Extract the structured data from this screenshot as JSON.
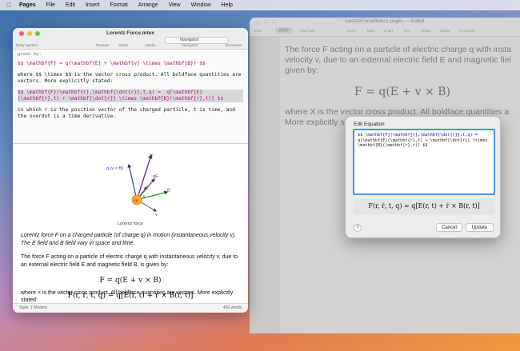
{
  "menubar": {
    "app": "Pages",
    "items": [
      "File",
      "Edit",
      "Insert",
      "Format",
      "Arrange",
      "View",
      "Window",
      "Help"
    ]
  },
  "left_window": {
    "title": "Lorentz Force.mtex",
    "toolbar": {
      "entry_symbol": "Entry Symbol",
      "preview": "Preview",
      "share": "Share",
      "media": "Media",
      "navigator": "Navigator",
      "navigator_select": "Navigator",
      "document": "Document"
    },
    "source": {
      "clip_line": "given by:",
      "line1": "$$ \\mathbf{F} = q(\\mathbf{E} + \\mathbf{v} \\times \\mathbf{B}) $$",
      "line2": "where $$ \\times $$ is the vector cross product. All boldface quantities are vectors. More explicitly stated:",
      "line3": "$$ \\mathbf{F}(\\mathbf{r},\\mathbf{\\dot{r}},t,q) =  q[\\mathbf{E}(\\mathbf{r},t) + \\mathbf{\\dot{r}} \\times \\mathbf{B}(\\mathbf{r},t)] $$",
      "line4": "in which r is the position vector of the charged particle, t is time, and the overdot is a time derivative."
    },
    "diagram": {
      "label_F": "F",
      "label_qvB": "q (v × B)",
      "label_qE": "qE",
      "label_E": "E",
      "label_B": "B",
      "label_v": "v",
      "label_q": "+q",
      "label_theta": "θ",
      "caption": "Lorentz force"
    },
    "preview": {
      "caption": "Lorentz force F on a charged particle (of charge q) in motion (instantaneous velocity v). The E field and B field vary in space and time.",
      "para1": "The force F acting on a particle of electric charge q with instantaneous velocity v, due to an external electric field E and magnetic field B, is given by:",
      "eq1": "F = q(E + v × B)",
      "para2": "where × is the vector cross product. All boldface quantities are vectors. More explicitly stated:",
      "eq2": "F(r, ṙ, t, q) = q[E(r, t) + ṙ × B(r, t)]"
    },
    "status": {
      "style": "Style: ‡ Modern",
      "words": "460 words"
    }
  },
  "right_window": {
    "title": "LorentzForceNotes1.pages — Edited",
    "zoom": "150%",
    "toolbar": [
      "View",
      "Zoom",
      "Add Page",
      "Insert",
      "Table",
      "Chart",
      "Text",
      "Shape",
      "Media",
      "Comment"
    ],
    "para1": "The force F acting on a particle of electric charge q with insta velocity v, due to an external electric field E and magnetic fiel given by:",
    "eq": "F = q(E + v × B)",
    "para2": "where X is the vector cross product. All boldface quantities a More explicitly stated:"
  },
  "dialog": {
    "title": "Edit Equation",
    "text": "$$ \\mathbf{F}(\\mathbf{r},\\mathbf{\\dot{r}},t,q) = q[\\mathbf{E}(\\mathbf{r},t) + \\mathbf{\\dot{r}} \\times \\mathbf{B}(\\mathbf{r},t)] $$",
    "preview": "F(r, ṙ, t, q) = q[E(r, t) + ṙ × B(r, t)]",
    "help": "?",
    "cancel": "Cancel",
    "update": "Update"
  }
}
